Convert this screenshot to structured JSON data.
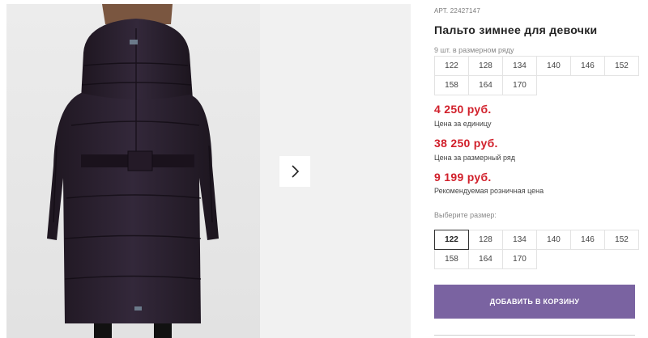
{
  "product": {
    "sku_prefix": "АРТ.",
    "sku": "22427147",
    "title": "Пальто зимнее для девочки"
  },
  "pack": {
    "note": "9 шт. в размерном ряду",
    "sizes": [
      "122",
      "128",
      "134",
      "140",
      "146",
      "152",
      "158",
      "164",
      "170"
    ]
  },
  "prices": {
    "unit_value": "4 250 руб.",
    "unit_label": "Цена за единицу",
    "pack_value": "38 250 руб.",
    "pack_label": "Цена за размерный ряд",
    "retail_value": "9 199 руб.",
    "retail_label": "Рекомендуемая розничная цена"
  },
  "size_select": {
    "label": "Выберите размер:",
    "sizes": [
      "122",
      "128",
      "134",
      "140",
      "146",
      "152",
      "158",
      "164",
      "170"
    ],
    "selected": "122"
  },
  "actions": {
    "add_to_cart": "ДОБАВИТЬ В КОРЗИНУ"
  },
  "gallery": {
    "next_icon": "chevron-right-icon"
  },
  "colors": {
    "price": "#d1202b",
    "button": "#7a63a1",
    "coat": "#2a1f2b"
  }
}
